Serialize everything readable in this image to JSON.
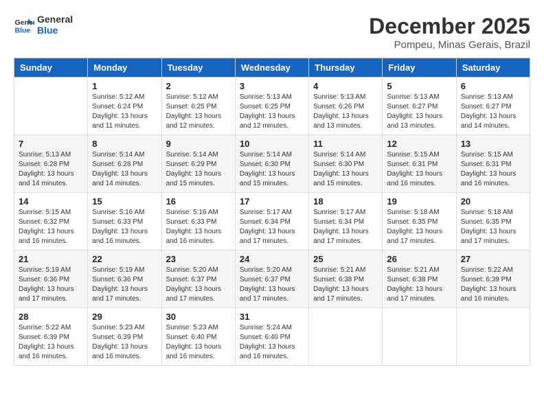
{
  "logo": {
    "line1": "General",
    "line2": "Blue"
  },
  "title": "December 2025",
  "subtitle": "Pompeu, Minas Gerais, Brazil",
  "weekdays": [
    "Sunday",
    "Monday",
    "Tuesday",
    "Wednesday",
    "Thursday",
    "Friday",
    "Saturday"
  ],
  "weeks": [
    [
      {
        "day": "",
        "sunrise": "",
        "sunset": "",
        "daylight": ""
      },
      {
        "day": "1",
        "sunrise": "Sunrise: 5:12 AM",
        "sunset": "Sunset: 6:24 PM",
        "daylight": "Daylight: 13 hours and 11 minutes."
      },
      {
        "day": "2",
        "sunrise": "Sunrise: 5:12 AM",
        "sunset": "Sunset: 6:25 PM",
        "daylight": "Daylight: 13 hours and 12 minutes."
      },
      {
        "day": "3",
        "sunrise": "Sunrise: 5:13 AM",
        "sunset": "Sunset: 6:25 PM",
        "daylight": "Daylight: 13 hours and 12 minutes."
      },
      {
        "day": "4",
        "sunrise": "Sunrise: 5:13 AM",
        "sunset": "Sunset: 6:26 PM",
        "daylight": "Daylight: 13 hours and 13 minutes."
      },
      {
        "day": "5",
        "sunrise": "Sunrise: 5:13 AM",
        "sunset": "Sunset: 6:27 PM",
        "daylight": "Daylight: 13 hours and 13 minutes."
      },
      {
        "day": "6",
        "sunrise": "Sunrise: 5:13 AM",
        "sunset": "Sunset: 6:27 PM",
        "daylight": "Daylight: 13 hours and 14 minutes."
      }
    ],
    [
      {
        "day": "7",
        "sunrise": "Sunrise: 5:13 AM",
        "sunset": "Sunset: 6:28 PM",
        "daylight": "Daylight: 13 hours and 14 minutes."
      },
      {
        "day": "8",
        "sunrise": "Sunrise: 5:14 AM",
        "sunset": "Sunset: 6:28 PM",
        "daylight": "Daylight: 13 hours and 14 minutes."
      },
      {
        "day": "9",
        "sunrise": "Sunrise: 5:14 AM",
        "sunset": "Sunset: 6:29 PM",
        "daylight": "Daylight: 13 hours and 15 minutes."
      },
      {
        "day": "10",
        "sunrise": "Sunrise: 5:14 AM",
        "sunset": "Sunset: 6:30 PM",
        "daylight": "Daylight: 13 hours and 15 minutes."
      },
      {
        "day": "11",
        "sunrise": "Sunrise: 5:14 AM",
        "sunset": "Sunset: 6:30 PM",
        "daylight": "Daylight: 13 hours and 15 minutes."
      },
      {
        "day": "12",
        "sunrise": "Sunrise: 5:15 AM",
        "sunset": "Sunset: 6:31 PM",
        "daylight": "Daylight: 13 hours and 16 minutes."
      },
      {
        "day": "13",
        "sunrise": "Sunrise: 5:15 AM",
        "sunset": "Sunset: 6:31 PM",
        "daylight": "Daylight: 13 hours and 16 minutes."
      }
    ],
    [
      {
        "day": "14",
        "sunrise": "Sunrise: 5:15 AM",
        "sunset": "Sunset: 6:32 PM",
        "daylight": "Daylight: 13 hours and 16 minutes."
      },
      {
        "day": "15",
        "sunrise": "Sunrise: 5:16 AM",
        "sunset": "Sunset: 6:33 PM",
        "daylight": "Daylight: 13 hours and 16 minutes."
      },
      {
        "day": "16",
        "sunrise": "Sunrise: 5:16 AM",
        "sunset": "Sunset: 6:33 PM",
        "daylight": "Daylight: 13 hours and 16 minutes."
      },
      {
        "day": "17",
        "sunrise": "Sunrise: 5:17 AM",
        "sunset": "Sunset: 6:34 PM",
        "daylight": "Daylight: 13 hours and 17 minutes."
      },
      {
        "day": "18",
        "sunrise": "Sunrise: 5:17 AM",
        "sunset": "Sunset: 6:34 PM",
        "daylight": "Daylight: 13 hours and 17 minutes."
      },
      {
        "day": "19",
        "sunrise": "Sunrise: 5:18 AM",
        "sunset": "Sunset: 6:35 PM",
        "daylight": "Daylight: 13 hours and 17 minutes."
      },
      {
        "day": "20",
        "sunrise": "Sunrise: 5:18 AM",
        "sunset": "Sunset: 6:35 PM",
        "daylight": "Daylight: 13 hours and 17 minutes."
      }
    ],
    [
      {
        "day": "21",
        "sunrise": "Sunrise: 5:19 AM",
        "sunset": "Sunset: 6:36 PM",
        "daylight": "Daylight: 13 hours and 17 minutes."
      },
      {
        "day": "22",
        "sunrise": "Sunrise: 5:19 AM",
        "sunset": "Sunset: 6:36 PM",
        "daylight": "Daylight: 13 hours and 17 minutes."
      },
      {
        "day": "23",
        "sunrise": "Sunrise: 5:20 AM",
        "sunset": "Sunset: 6:37 PM",
        "daylight": "Daylight: 13 hours and 17 minutes."
      },
      {
        "day": "24",
        "sunrise": "Sunrise: 5:20 AM",
        "sunset": "Sunset: 6:37 PM",
        "daylight": "Daylight: 13 hours and 17 minutes."
      },
      {
        "day": "25",
        "sunrise": "Sunrise: 5:21 AM",
        "sunset": "Sunset: 6:38 PM",
        "daylight": "Daylight: 13 hours and 17 minutes."
      },
      {
        "day": "26",
        "sunrise": "Sunrise: 5:21 AM",
        "sunset": "Sunset: 6:38 PM",
        "daylight": "Daylight: 13 hours and 17 minutes."
      },
      {
        "day": "27",
        "sunrise": "Sunrise: 5:22 AM",
        "sunset": "Sunset: 6:39 PM",
        "daylight": "Daylight: 13 hours and 16 minutes."
      }
    ],
    [
      {
        "day": "28",
        "sunrise": "Sunrise: 5:22 AM",
        "sunset": "Sunset: 6:39 PM",
        "daylight": "Daylight: 13 hours and 16 minutes."
      },
      {
        "day": "29",
        "sunrise": "Sunrise: 5:23 AM",
        "sunset": "Sunset: 6:39 PM",
        "daylight": "Daylight: 13 hours and 16 minutes."
      },
      {
        "day": "30",
        "sunrise": "Sunrise: 5:23 AM",
        "sunset": "Sunset: 6:40 PM",
        "daylight": "Daylight: 13 hours and 16 minutes."
      },
      {
        "day": "31",
        "sunrise": "Sunrise: 5:24 AM",
        "sunset": "Sunset: 6:40 PM",
        "daylight": "Daylight: 13 hours and 16 minutes."
      },
      {
        "day": "",
        "sunrise": "",
        "sunset": "",
        "daylight": ""
      },
      {
        "day": "",
        "sunrise": "",
        "sunset": "",
        "daylight": ""
      },
      {
        "day": "",
        "sunrise": "",
        "sunset": "",
        "daylight": ""
      }
    ]
  ]
}
